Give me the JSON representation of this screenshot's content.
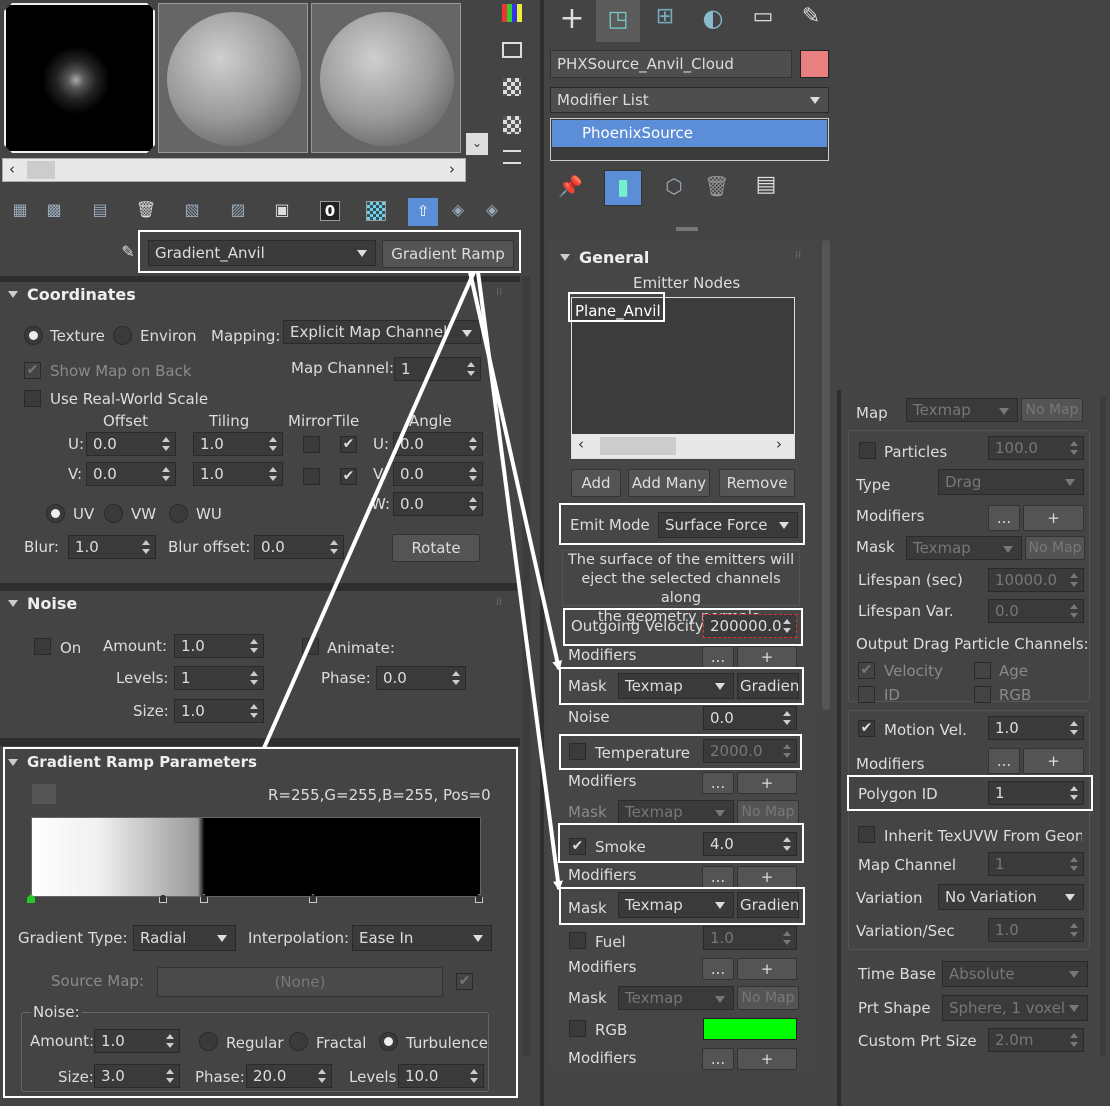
{
  "left": {
    "map_name": "Gradient_Anvil",
    "map_type": "Gradient Ramp",
    "coords": {
      "title": "Coordinates",
      "texture": "Texture",
      "environ": "Environ",
      "mapping_label": "Mapping:",
      "mapping_value": "Explicit Map Channel",
      "show_map": "Show Map on Back",
      "map_channel_label": "Map Channel:",
      "map_channel": "1",
      "real_world": "Use Real-World Scale",
      "offset": "Offset",
      "tiling": "Tiling",
      "mirror": "Mirror",
      "tile": "Tile",
      "angle": "Angle",
      "u": "U:",
      "v": "V:",
      "w": "W:",
      "u_off": "0.0",
      "v_off": "0.0",
      "u_til": "1.0",
      "v_til": "1.0",
      "u_ang": "0.0",
      "v_ang": "0.0",
      "w_ang": "0.0",
      "uv": "UV",
      "vw": "VW",
      "wu": "WU",
      "blur_label": "Blur:",
      "blur": "1.0",
      "blur_off_label": "Blur offset:",
      "blur_off": "0.0",
      "rotate": "Rotate"
    },
    "noise": {
      "title": "Noise",
      "on": "On",
      "amount_label": "Amount:",
      "amount": "1.0",
      "animate": "Animate:",
      "levels_label": "Levels:",
      "levels": "1",
      "phase_label": "Phase:",
      "phase": "0.0",
      "size_label": "Size:",
      "size": "1.0"
    },
    "grad": {
      "title": "Gradient Ramp Parameters",
      "rgb": "R=255,G=255,B=255, Pos=0",
      "type_label": "Gradient Type:",
      "type": "Radial",
      "interp_label": "Interpolation:",
      "interp": "Ease In",
      "source_label": "Source Map:",
      "source": "(None)",
      "noise": "Noise:",
      "amount_label": "Amount:",
      "amount": "1.0",
      "regular": "Regular",
      "fractal": "Fractal",
      "turbulence": "Turbulence",
      "size_label": "Size:",
      "size": "3.0",
      "phase_label": "Phase:",
      "phase": "20.0",
      "levels_label": "Levels:",
      "levels": "10.0"
    }
  },
  "mid": {
    "object_name": "PHXSource_Anvil_Cloud",
    "modifier_list": "Modifier List",
    "stack_item": "PhoenixSource",
    "general": "General",
    "emitter_nodes": "Emitter Nodes",
    "node": "Plane_Anvil",
    "add": "Add",
    "add_many": "Add Many",
    "remove": "Remove",
    "emit_mode_label": "Emit Mode",
    "emit_mode": "Surface Force",
    "desc": [
      "The surface of the emitters will",
      "eject the selected channels along",
      "the geometry normals."
    ],
    "velocity_label": "Outgoing Velocity",
    "velocity": "200000.0",
    "modifiers": "Modifiers",
    "dots": "...",
    "plus": "+",
    "mask": "Mask",
    "texmap": "Texmap",
    "gradient": "Gradient",
    "no_map": "No Map",
    "noise_label": "Noise",
    "noise": "0.0",
    "temperature": "Temperature",
    "temp_val": "2000.0",
    "smoke": "Smoke",
    "smoke_val": "4.0",
    "fuel": "Fuel",
    "fuel_val": "1.0",
    "rgb": "RGB"
  },
  "right": {
    "map": "Map",
    "texmap": "Texmap",
    "no_map": "No Map",
    "particles": "Particles",
    "particles_val": "100.0",
    "type_label": "Type",
    "type": "Drag",
    "modifiers": "Modifiers",
    "dots": "...",
    "plus": "+",
    "mask": "Mask",
    "lifespan": "Lifespan (sec)",
    "lifespan_val": "10000.0",
    "lifespan_var": "Lifespan Var.",
    "lifespan_var_val": "0.0",
    "output": "Output Drag Particle Channels:",
    "velocity": "Velocity",
    "age": "Age",
    "id": "ID",
    "rgb": "RGB",
    "motion_vel": "Motion Vel.",
    "motion_vel_val": "1.0",
    "polygon_id": "Polygon ID",
    "polygon_id_val": "1",
    "inherit": "Inherit TexUVW From Geon",
    "map_channel": "Map Channel",
    "map_channel_val": "1",
    "variation": "Variation",
    "variation_val": "No Variation",
    "var_sec": "Variation/Sec",
    "var_sec_val": "1.0",
    "time_base": "Time Base",
    "time_base_val": "Absolute",
    "prt_shape": "Prt Shape",
    "prt_shape_val": "Sphere, 1 voxel",
    "custom_size": "Custom Prt Size",
    "custom_size_val": "2.0m"
  },
  "colors": {
    "accent": "#5b8ed6",
    "swatch": "#e88080",
    "rgb_swatch": "#00ff00",
    "stack_bg": "#5b8ed6"
  }
}
